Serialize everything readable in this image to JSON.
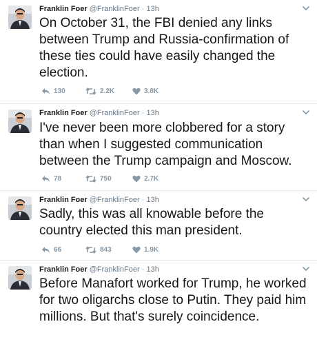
{
  "tweets": [
    {
      "name": "Franklin Foer",
      "handle": "@FranklinFoer",
      "time": "· 13h",
      "text": "On October 31, the FBI denied any links between Trump and Russia-confirmation of these ties could have easily changed the election.",
      "replies": "130",
      "retweets": "2.2K",
      "likes": "3.8K"
    },
    {
      "name": "Franklin Foer",
      "handle": "@FranklinFoer",
      "time": "· 13h",
      "text": "I've never been more clobbered for a story than when I suggested communication between the Trump campaign and Moscow.",
      "replies": "78",
      "retweets": "750",
      "likes": "2.7K"
    },
    {
      "name": "Franklin Foer",
      "handle": "@FranklinFoer",
      "time": "· 13h",
      "text": "Sadly, this was all knowable before the country elected this man president.",
      "replies": "66",
      "retweets": "843",
      "likes": "1.9K"
    },
    {
      "name": "Franklin Foer",
      "handle": "@FranklinFoer",
      "time": "· 13h",
      "text": "Before Manafort worked for Trump, he worked for two oligarchs close to Putin. They paid him millions. But that's surely coincidence."
    }
  ],
  "colors": {
    "text": "#14171a",
    "muted": "#657786",
    "icon": "#8899a6",
    "divider": "#e1e8ed"
  },
  "icons": {
    "reply": "reply-icon",
    "retweet": "retweet-icon",
    "like": "heart-icon",
    "menu": "chevron-down-icon"
  }
}
